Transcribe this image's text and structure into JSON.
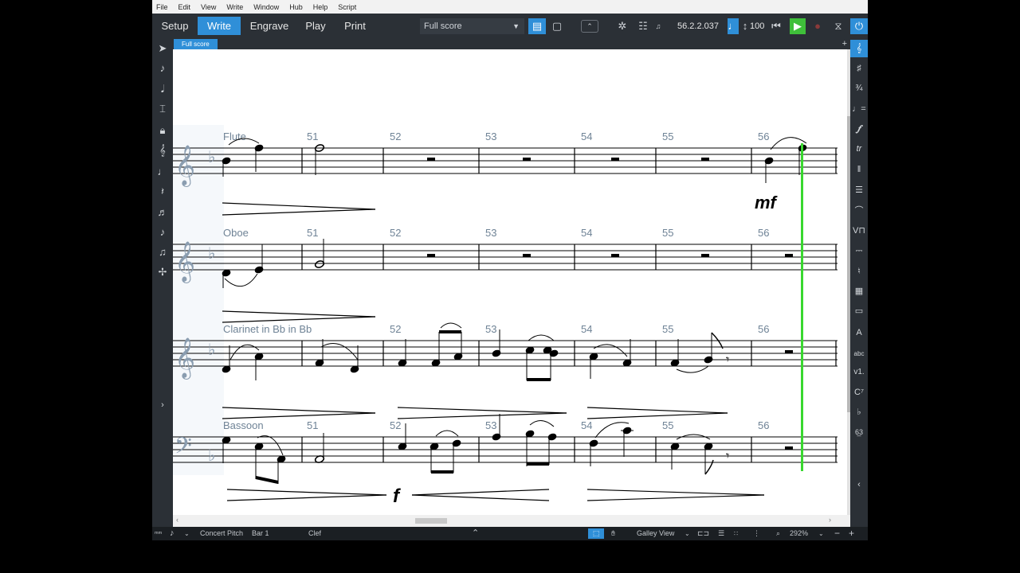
{
  "menu": [
    "File",
    "Edit",
    "View",
    "Write",
    "Window",
    "Hub",
    "Help",
    "Script"
  ],
  "modes": [
    {
      "label": "Setup",
      "active": false
    },
    {
      "label": "Write",
      "active": true
    },
    {
      "label": "Engrave",
      "active": false
    },
    {
      "label": "Play",
      "active": false
    },
    {
      "label": "Print",
      "active": false
    }
  ],
  "layout_select": "Full score",
  "position_readout": "56.2.2.037",
  "tempo_value": "100",
  "score_tab": "Full score",
  "staves": [
    {
      "name": "Flute"
    },
    {
      "name": "Oboe"
    },
    {
      "name": "Clarinet in Bb in Bb"
    },
    {
      "name": "Bassoon"
    }
  ],
  "bar_numbers": [
    "51",
    "52",
    "53",
    "54",
    "55",
    "56"
  ],
  "dynamics": {
    "mf": "mf",
    "f": "f"
  },
  "status": {
    "concert_pitch": "Concert Pitch",
    "bar": "Bar 1",
    "clef": "Clef",
    "view": "Galley View",
    "zoom": "292%"
  },
  "colors": {
    "accent": "#2f8fd8",
    "playhead": "#39d82f",
    "play_button": "#3fbf3a"
  },
  "icons": {
    "left_panel": [
      "select-arrow-icon",
      "voice-input-icon",
      "note-input-icon",
      "insert-icon",
      "lock-icon",
      "chord-icon",
      "note-icon",
      "rest-icon",
      "tuplet-icon",
      "grace-note-icon",
      "slash-icon",
      "stem-icon"
    ],
    "right_panel": [
      "clef-icon",
      "key-signature-icon",
      "time-signature-icon",
      "tempo-icon",
      "dynamics-icon",
      "ornaments-icon",
      "bars-icon",
      "repeat-icon",
      "holds-icon",
      "playing-techniques-icon",
      "lines-icon",
      "audio-icon",
      "jump-icon",
      "comment-icon",
      "text-icon",
      "lyrics-icon",
      "chord-symbol-icon",
      "figured-bass-icon",
      "fingering-icon"
    ]
  }
}
